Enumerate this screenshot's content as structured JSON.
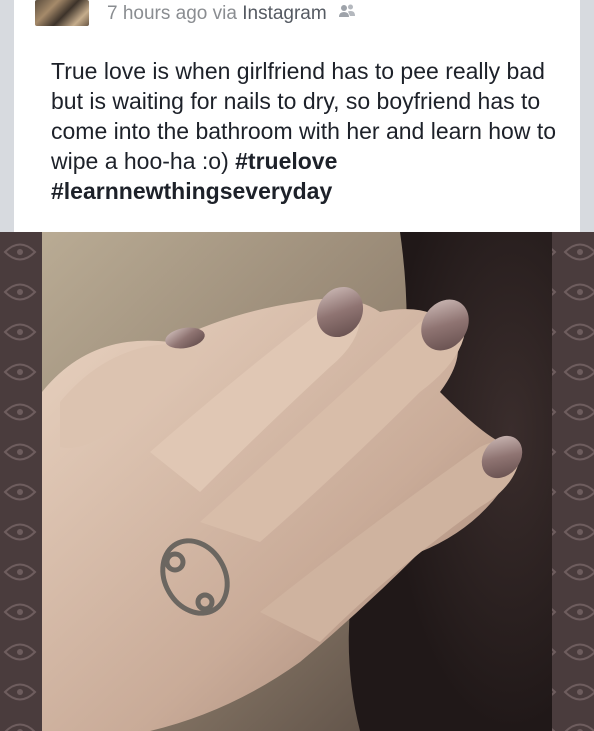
{
  "post": {
    "timestamp": "7 hours ago",
    "via_label": "via",
    "source": "Instagram",
    "audience_icon": "friends-icon",
    "text": "True love is when girlfriend has to pee really bad but is waiting for nails to dry, so boyfriend has to come into the bathroom with her and learn how to wipe a hoo-ha :o)",
    "hashtags": [
      "#truelove",
      "#learnnewthingseveryday"
    ]
  },
  "colors": {
    "meta_text": "#8a8d91",
    "body_text": "#1d2129",
    "background": "#e9ebee"
  }
}
